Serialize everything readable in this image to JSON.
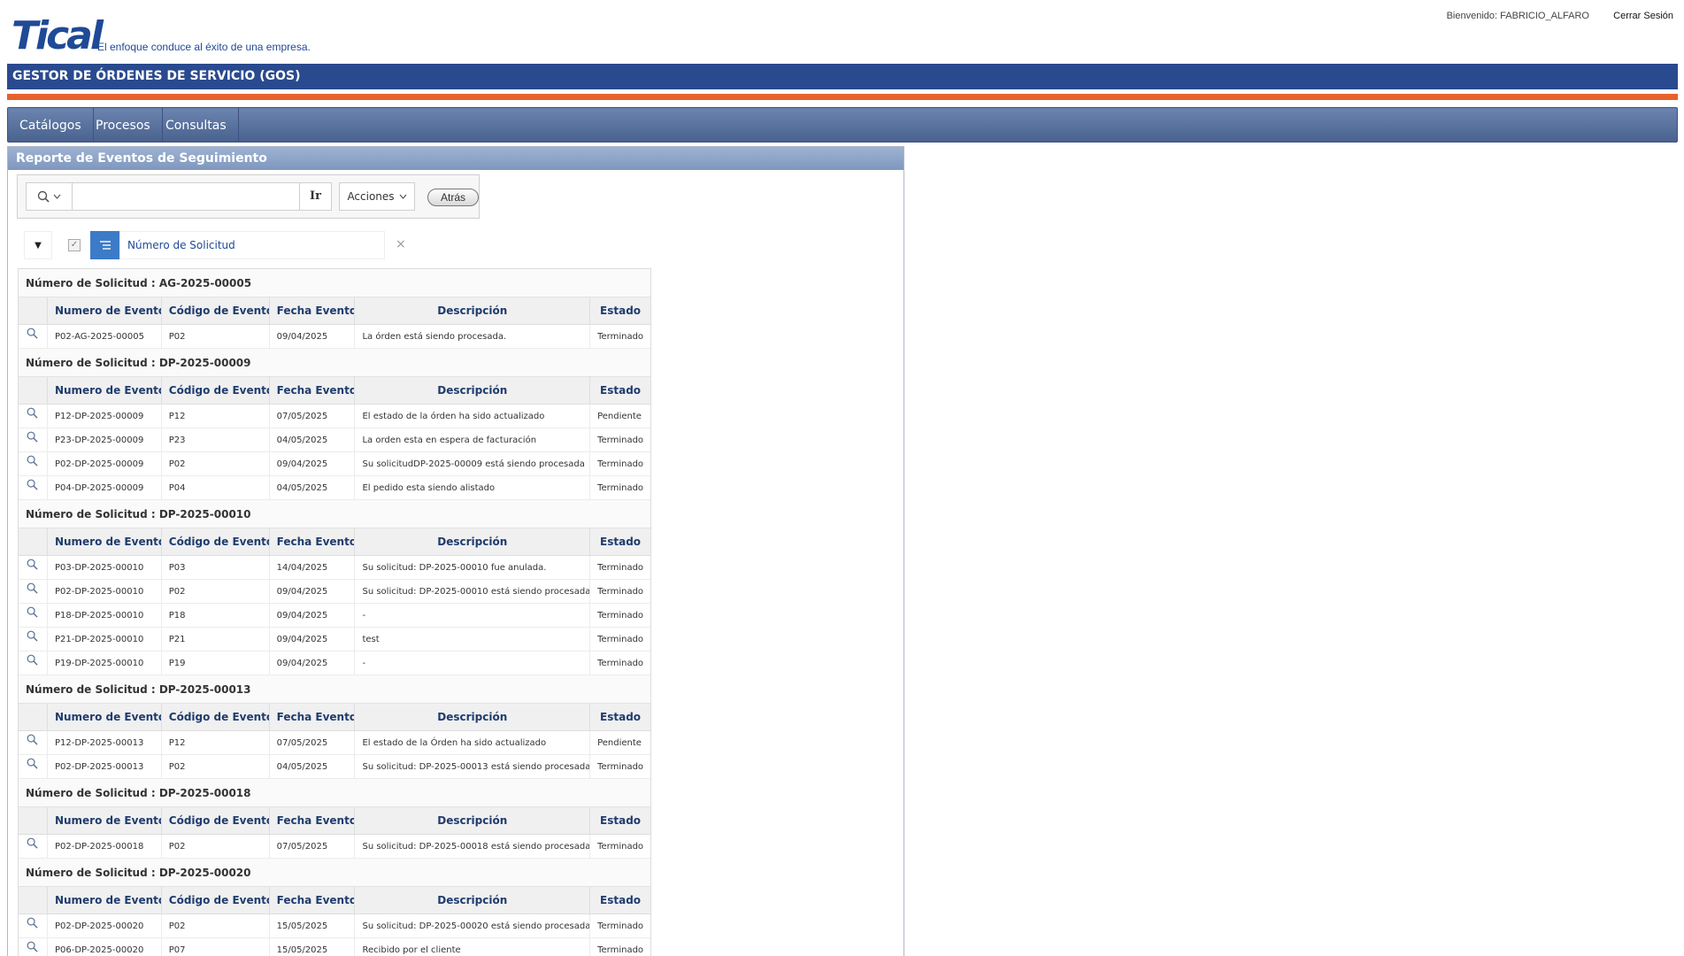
{
  "header": {
    "logo_text": "Tical",
    "tagline": "El enfoque conduce al éxito de una empresa.",
    "welcome": "Bienvenido: FABRICIO_ALFARO",
    "logout": "Cerrar Sesión",
    "app_title": "GESTOR DE ÓRDENES DE SERVICIO (GOS)",
    "brand_color": "#2a4a8f",
    "accent_color": "#e8612c"
  },
  "nav": {
    "items": [
      {
        "label": "Catálogos"
      },
      {
        "label": "Procesos"
      },
      {
        "label": "Consultas"
      }
    ]
  },
  "region": {
    "title": "Reporte de Eventos de Seguimiento"
  },
  "toolbar": {
    "search_icon": "search-icon",
    "search_value": "",
    "go_label": "Ir",
    "actions_label": "Acciones",
    "back_label": "Atrás"
  },
  "filter": {
    "label": "Número de Solicitud",
    "remove_glyph": "×"
  },
  "report": {
    "group_prefix": "Número de Solicitud : ",
    "columns": [
      "Numero de Evento",
      "Código de Evento",
      "Fecha Evento",
      "Descripción",
      "Estado"
    ],
    "groups": [
      {
        "id": "AG-2025-00005",
        "rows": [
          [
            "P02-AG-2025-00005",
            "P02",
            "09/04/2025",
            "La órden está siendo procesada.",
            "Terminado"
          ]
        ]
      },
      {
        "id": "DP-2025-00009",
        "rows": [
          [
            "P12-DP-2025-00009",
            "P12",
            "07/05/2025",
            "El estado de la órden ha sido actualizado",
            "Pendiente"
          ],
          [
            "P23-DP-2025-00009",
            "P23",
            "04/05/2025",
            "La orden esta en espera de facturación",
            "Terminado"
          ],
          [
            "P02-DP-2025-00009",
            "P02",
            "09/04/2025",
            "Su solicitudDP-2025-00009 está siendo procesada",
            "Terminado"
          ],
          [
            "P04-DP-2025-00009",
            "P04",
            "04/05/2025",
            "El pedido esta siendo alistado",
            "Terminado"
          ]
        ]
      },
      {
        "id": "DP-2025-00010",
        "rows": [
          [
            "P03-DP-2025-00010",
            "P03",
            "14/04/2025",
            "Su solicitud: DP-2025-00010 fue anulada.",
            "Terminado"
          ],
          [
            "P02-DP-2025-00010",
            "P02",
            "09/04/2025",
            "Su solicitud: DP-2025-00010 está siendo procesada",
            "Terminado"
          ],
          [
            "P18-DP-2025-00010",
            "P18",
            "09/04/2025",
            "-",
            "Terminado"
          ],
          [
            "P21-DP-2025-00010",
            "P21",
            "09/04/2025",
            "test",
            "Terminado"
          ],
          [
            "P19-DP-2025-00010",
            "P19",
            "09/04/2025",
            "-",
            "Terminado"
          ]
        ]
      },
      {
        "id": "DP-2025-00013",
        "rows": [
          [
            "P12-DP-2025-00013",
            "P12",
            "07/05/2025",
            "El estado de la Órden ha sido actualizado",
            "Pendiente"
          ],
          [
            "P02-DP-2025-00013",
            "P02",
            "04/05/2025",
            "Su solicitud: DP-2025-00013 está siendo procesada",
            "Terminado"
          ]
        ]
      },
      {
        "id": "DP-2025-00018",
        "rows": [
          [
            "P02-DP-2025-00018",
            "P02",
            "07/05/2025",
            "Su solicitud: DP-2025-00018 está siendo procesada",
            "Terminado"
          ]
        ]
      },
      {
        "id": "DP-2025-00020",
        "rows": [
          [
            "P02-DP-2025-00020",
            "P02",
            "15/05/2025",
            "Su solicitud: DP-2025-00020 está siendo procesada",
            "Terminado"
          ],
          [
            "P06-DP-2025-00020",
            "P07",
            "15/05/2025",
            "Recibido por el cliente",
            "Terminado"
          ]
        ]
      }
    ]
  }
}
